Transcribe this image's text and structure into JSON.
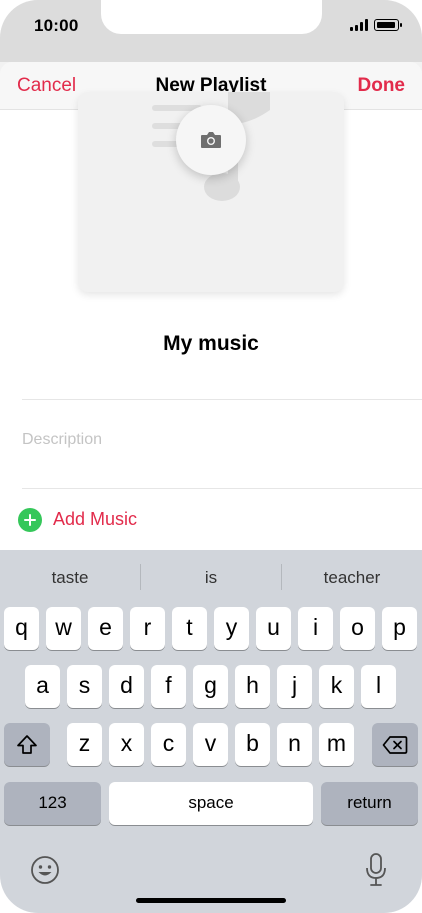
{
  "status_bar": {
    "time": "10:00"
  },
  "nav": {
    "cancel_label": "Cancel",
    "title": "New Playlist",
    "done_label": "Done"
  },
  "playlist": {
    "name": "My music",
    "description_placeholder": "Description",
    "add_music_label": "Add Music"
  },
  "keyboard": {
    "suggestions": [
      "taste",
      "is",
      "teacher"
    ],
    "row1": [
      "q",
      "w",
      "e",
      "r",
      "t",
      "y",
      "u",
      "i",
      "o",
      "p"
    ],
    "row2": [
      "a",
      "s",
      "d",
      "f",
      "g",
      "h",
      "j",
      "k",
      "l"
    ],
    "row3": [
      "z",
      "x",
      "c",
      "v",
      "b",
      "n",
      "m"
    ],
    "numbers_label": "123",
    "space_label": "space",
    "return_label": "return"
  },
  "colors": {
    "accent": "#e22b4b",
    "add_icon": "#35c75a",
    "keyboard_bg": "#d1d5db"
  },
  "icons": [
    "camera-icon",
    "shift-icon",
    "backspace-icon",
    "emoji-icon",
    "microphone-icon",
    "plus-icon"
  ]
}
